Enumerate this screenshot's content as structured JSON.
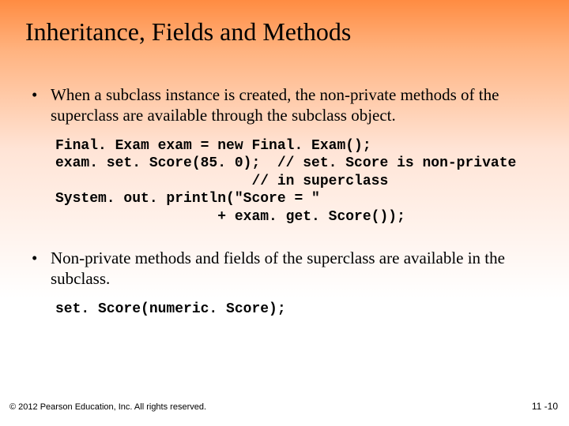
{
  "title": "Inheritance, Fields and Methods",
  "bullets": [
    "When a subclass instance is created, the non-private methods of the superclass are available through the subclass object.",
    "Non-private methods and fields of the superclass are available in the subclass."
  ],
  "code1": "Final. Exam exam = new Final. Exam();\nexam. set. Score(85. 0);  // set. Score is non-private\n                       // in superclass\nSystem. out. println(\"Score = \"\n                   + exam. get. Score());",
  "code2": "set. Score(numeric. Score);",
  "footer": {
    "copyright": "© 2012 Pearson Education, Inc. All rights reserved.",
    "pagenum": "11 -10"
  }
}
